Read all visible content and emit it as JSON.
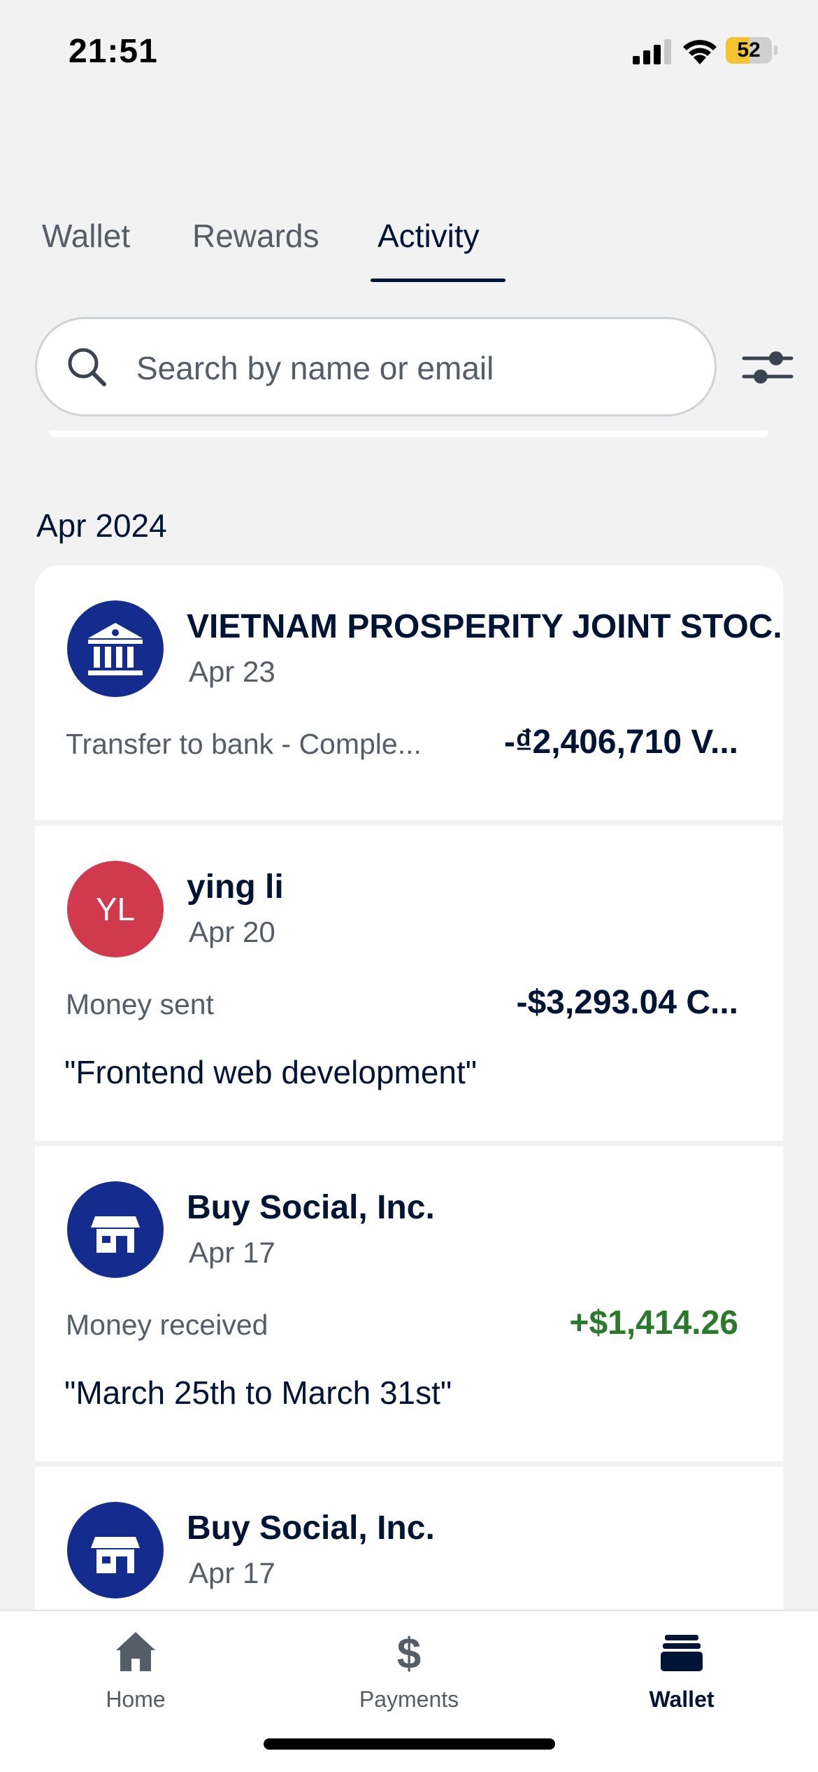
{
  "status_bar": {
    "time": "21:51",
    "battery_level": "52",
    "battery_percent": 52,
    "battery_color": "#f4c430"
  },
  "tabs": [
    {
      "label": "Wallet",
      "active": false
    },
    {
      "label": "Rewards",
      "active": false
    },
    {
      "label": "Activity",
      "active": true
    }
  ],
  "search": {
    "placeholder": "Search by name or email",
    "value": "",
    "icon": "search-icon",
    "filter_icon": "sliders-icon"
  },
  "activity": {
    "month_header": "Apr 2024",
    "items": [
      {
        "name": "VIETNAM PROSPERITY JOINT STOC...",
        "date": "Apr 23",
        "description": "Transfer to bank - Comple...",
        "amount": "-₫2,406,710 V...",
        "avatar_icon": "bank-icon",
        "avatar_color": "#142c8e"
      },
      {
        "name": "ying li",
        "date": "Apr 20",
        "description": "Money sent",
        "amount": "-$3,293.04 C...",
        "note": "\"Frontend web development\"",
        "avatar_initials": "YL",
        "avatar_color": "#d1394c"
      },
      {
        "name": "Buy Social, Inc.",
        "date": "Apr 17",
        "description": "Money received",
        "amount": "+$1,414.26",
        "amount_color": "#2b7a2b",
        "note": "\"March 25th to March 31st\"",
        "avatar_icon": "store-icon",
        "avatar_color": "#142c8e"
      },
      {
        "name": "Buy Social, Inc.",
        "date": "Apr 17",
        "avatar_icon": "store-icon",
        "avatar_color": "#142c8e"
      }
    ]
  },
  "bottom_nav": [
    {
      "label": "Home",
      "icon": "home-icon",
      "active": false
    },
    {
      "label": "Payments",
      "icon": "dollar-icon",
      "active": false
    },
    {
      "label": "Wallet",
      "icon": "wallet-icon",
      "active": true
    }
  ],
  "colors": {
    "navy": "#001435",
    "muted": "#545d68",
    "positive": "#2b7a2b",
    "background": "#f2f2f2"
  }
}
